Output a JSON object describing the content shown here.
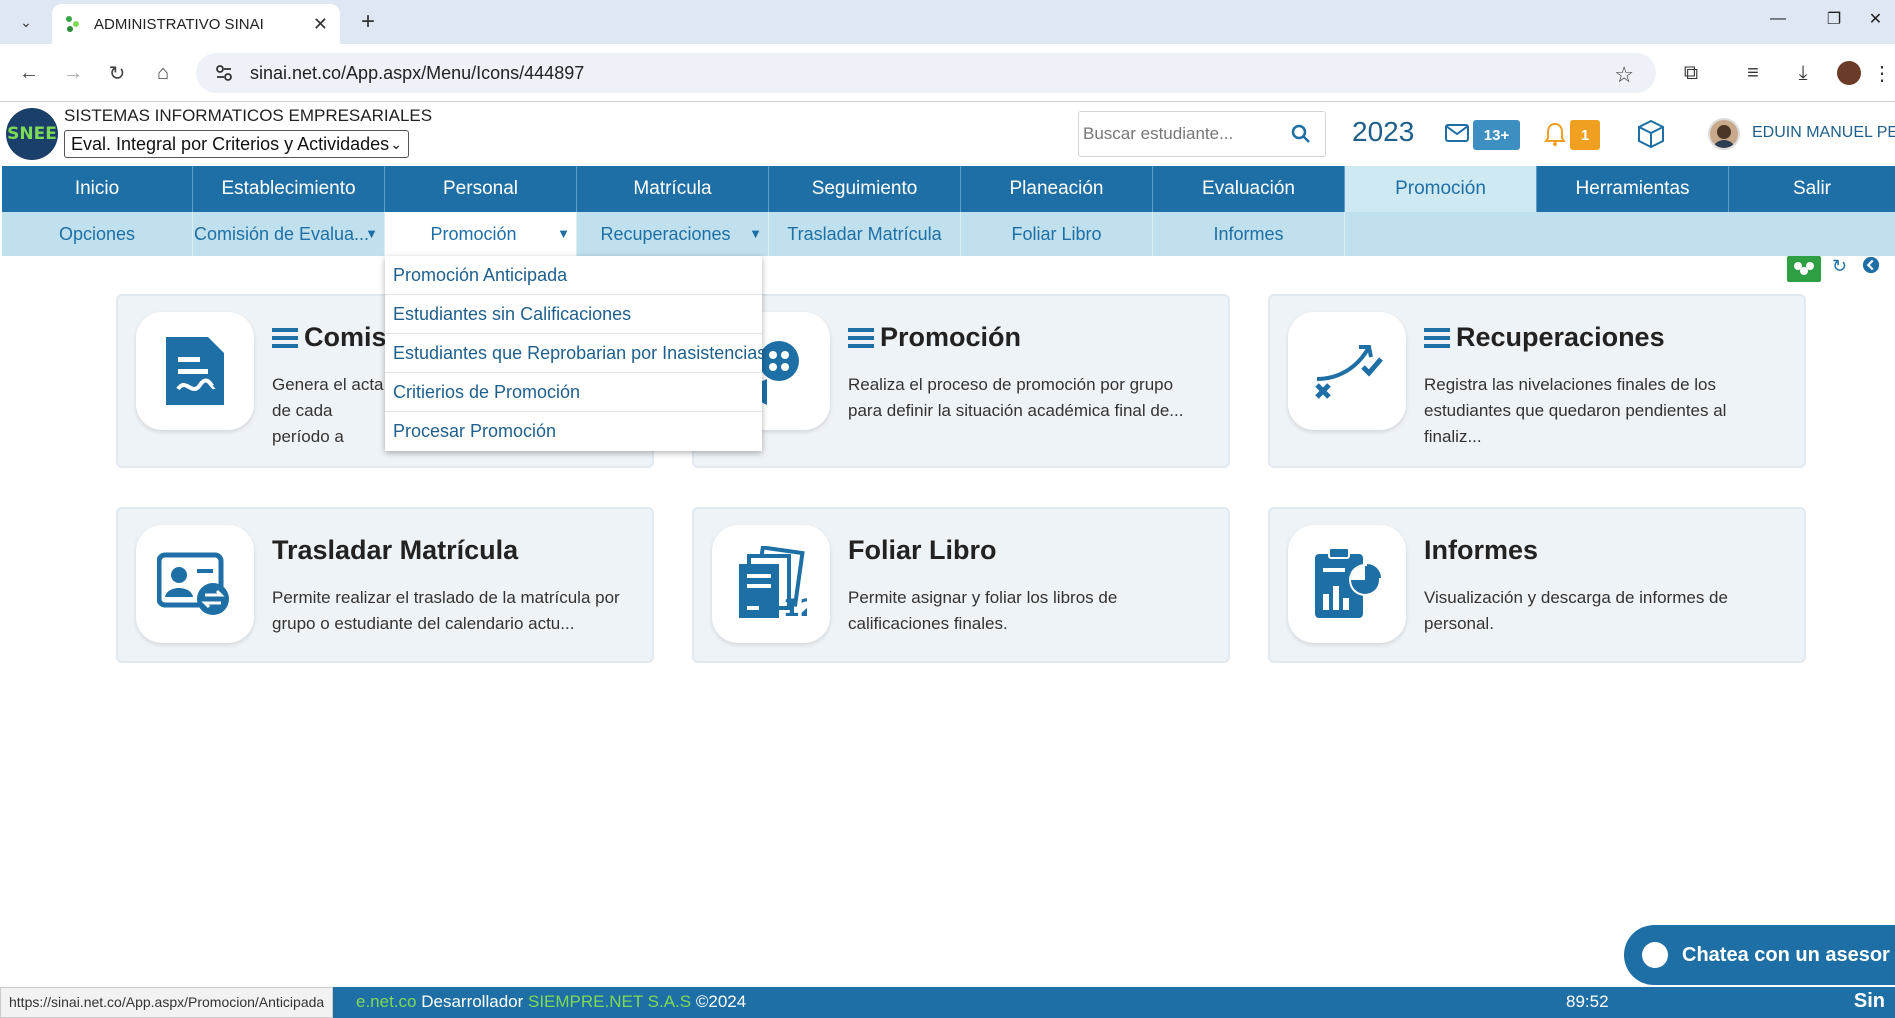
{
  "browser": {
    "tab_title": "ADMINISTRATIVO SINAI",
    "url": "sinai.net.co/App.aspx/Menu/Icons/444897",
    "status_url": "https://sinai.net.co/App.aspx/Promocion/Anticipada"
  },
  "header": {
    "logo_text": "SNEE",
    "company": "SISTEMAS INFORMATICOS EMPRESARIALES",
    "eval_select": "Eval. Integral por Criterios y Actividades",
    "search_placeholder": "Buscar estudiante...",
    "year": "2023",
    "mail_badge": "13+",
    "notif_badge": "1",
    "username": "EDUIN MANUEL PE..."
  },
  "main_menu": [
    {
      "label": "Inicio"
    },
    {
      "label": "Establecimiento"
    },
    {
      "label": "Personal"
    },
    {
      "label": "Matrícula"
    },
    {
      "label": "Seguimiento"
    },
    {
      "label": "Planeación"
    },
    {
      "label": "Evaluación"
    },
    {
      "label": "Promoción",
      "active": true
    },
    {
      "label": "Herramientas"
    },
    {
      "label": "Salir"
    }
  ],
  "sub_menu": [
    {
      "label": "Opciones"
    },
    {
      "label": "Comisión de Evalua..."
    },
    {
      "label": "Promoción"
    },
    {
      "label": "Recuperaciones"
    },
    {
      "label": "Trasladar Matrícula"
    },
    {
      "label": "Foliar Libro"
    },
    {
      "label": "Informes"
    }
  ],
  "dropdown": [
    "Promoción Anticipada",
    "Estudiantes sin Calificaciones",
    "Estudiantes que Reprobarian por Inasistencias",
    "Critierios de Promoción",
    "Procesar Promoción"
  ],
  "cards": [
    {
      "title": "Comisi",
      "desc": "Genera el acta de cada período a",
      "icon": "document-sign-icon"
    },
    {
      "title": "Promoción",
      "desc": "Realiza el proceso de promoción por grupo para definir la situación académica final de...",
      "icon": "promotion-icon"
    },
    {
      "title": "Recuperaciones",
      "desc": "Registra las nivelaciones finales de los estudiantes que quedaron pendientes al finaliz...",
      "icon": "recovery-curve-icon"
    },
    {
      "title": "Trasladar Matrícula",
      "desc": "Permite realizar el traslado de la matrícula por grupo o estudiante del calendario actu...",
      "icon": "transfer-student-icon"
    },
    {
      "title": "Foliar Libro",
      "desc": "Permite asignar y foliar los libros de calificaciones finales.",
      "icon": "numbered-pages-icon"
    },
    {
      "title": "Informes",
      "desc": "Visualización y descarga de informes de personal.",
      "icon": "report-chart-icon"
    }
  ],
  "chat": {
    "label": "Chatea con un asesor"
  },
  "footer": {
    "domain_fragment": "e.net.co",
    "dev_label": " Desarrollador ",
    "dev_name": "SIEMPRE.NET S.A.S",
    "copyright": " ©2024",
    "timer": "89:52",
    "brand": "Sin"
  },
  "colors": {
    "primary": "#1e6fa6",
    "submenu_bg": "#bfe0ec",
    "card_bg": "#eef3f7",
    "badge_blue": "#3d8fc2",
    "badge_orange": "#f0a020",
    "accent_green": "#7ed957"
  }
}
